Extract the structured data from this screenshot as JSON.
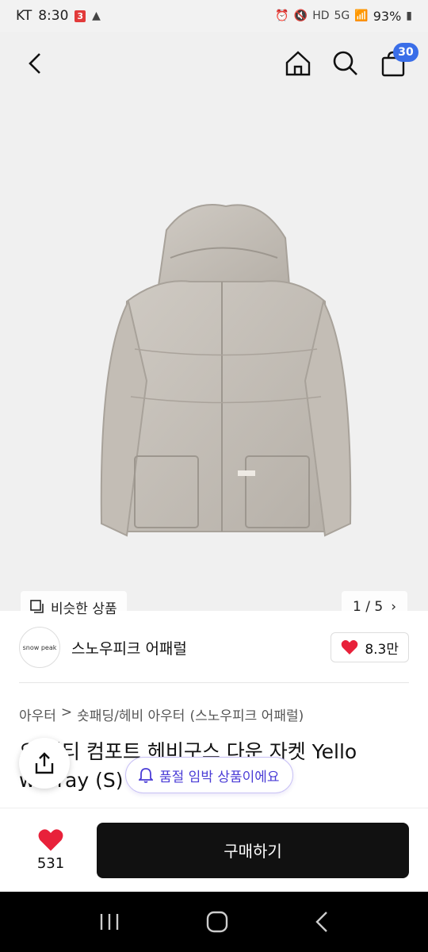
{
  "status_bar": {
    "carrier": "KT",
    "time": "8:30",
    "battery": "93%"
  },
  "nav": {
    "cart_count": "30"
  },
  "gallery": {
    "similar_label": "비슷한 상품",
    "pager": "1 / 5"
  },
  "seller": {
    "logo_text": "snow peak",
    "name": "스노우피크 어패럴",
    "likes": "8.3만"
  },
  "product": {
    "breadcrumb": [
      "아우터",
      ">",
      "숏패딩/헤비 아우터",
      "(스노우피크 어패럴)"
    ],
    "title_line1": "오 리티 컴포트 헤비구스 다운 자켓 Yello",
    "title_line2": "w Gray (S)"
  },
  "stock_notice": "품절 임박 상품이에요",
  "bottom": {
    "wish_count": "531",
    "buy_label": "구매하기"
  },
  "colors": {
    "heart": "#e8213a",
    "cart_badge": "#3a6ee8",
    "stock_text": "#4a3cd6"
  }
}
